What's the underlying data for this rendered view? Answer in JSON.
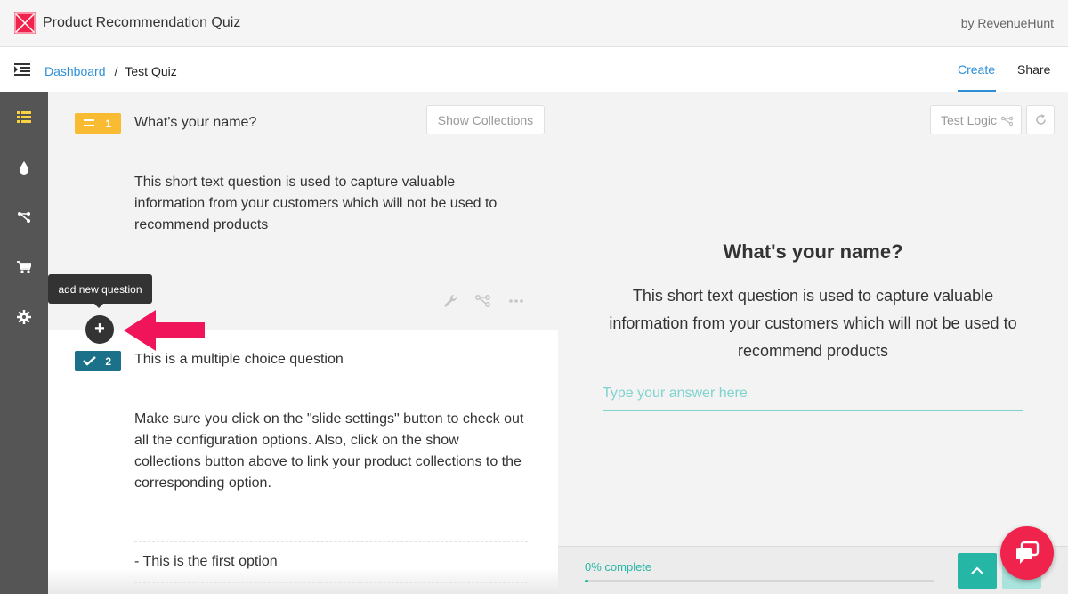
{
  "header": {
    "app_title": "Product Recommendation Quiz",
    "by_label": "by RevenueHunt",
    "brand_color": "#f0234c"
  },
  "nav": {
    "breadcrumb_link": "Dashboard",
    "breadcrumb_sep": "/",
    "breadcrumb_current": "Test Quiz",
    "tab_create": "Create",
    "tab_share": "Share",
    "accent": "#2e8fd6"
  },
  "sidebar": {
    "items": [
      "grid-icon",
      "drop-icon",
      "logic-icon",
      "cart-icon",
      "gear-icon"
    ],
    "active_color": "#f8d33f"
  },
  "editor": {
    "show_collections": "Show Collections",
    "tooltip": "add new question",
    "questions": [
      {
        "number": "1",
        "type_icon": "short-text-icon",
        "title": "What's your name?",
        "description": "This short text question is used to capture valuable information from your customers which will not be used to recommend products"
      },
      {
        "number": "2",
        "type_icon": "check-icon",
        "title": "This is a multiple choice question",
        "description": "Make sure you click on the \"slide settings\" button to check out all the configuration options. Also, click on the show collections button above to link your product collections to the corresponding option.",
        "option": "- This is the first option"
      }
    ]
  },
  "preview": {
    "test_logic": "Test Logic",
    "title": "What's your name?",
    "description": "This short text question is used to capture valuable information from your customers which will not be used to recommend products",
    "input_placeholder": "Type your answer here",
    "progress_label": "0% complete",
    "progress_fraction": 0.0,
    "teal": "#26b6a6"
  }
}
